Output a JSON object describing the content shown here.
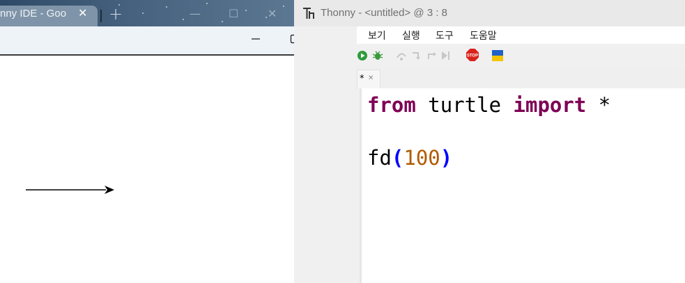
{
  "browser": {
    "tab_title": "nny IDE - Goo",
    "tab_close": "✕",
    "new_tab": "+",
    "controls": {
      "minimize": "—",
      "maximize": "☐",
      "close": "✕"
    }
  },
  "turtle_window": {
    "controls": {
      "minimize": "—",
      "maximize": "☐",
      "close": "✕"
    },
    "drawing": {
      "command": "fd(100)",
      "heading": "east",
      "pen_color": "#000000"
    }
  },
  "thonny": {
    "title": "Thonny  -  <untitled>  @  3 : 8",
    "menu": [
      "보기",
      "실행",
      "도구",
      "도움말"
    ],
    "toolbar": {
      "icons": [
        "run-icon",
        "debug-icon",
        "step-over-icon",
        "step-into-icon",
        "step-out-icon",
        "resume-icon",
        "stop-icon",
        "ukraine-flag-icon"
      ],
      "stop_label": "STOP"
    },
    "editor_tab": {
      "label": "*",
      "close": "✕"
    },
    "code": {
      "line1": {
        "kw1": "from",
        "name": " turtle ",
        "kw2": "import",
        "rest": " *"
      },
      "line3": {
        "func": "fd",
        "open": "(",
        "arg": "100",
        "close": ")"
      }
    }
  },
  "colors": {
    "keyword": "#7f0055",
    "paren": "#0000ff",
    "number": "#b05a00",
    "menu_bg": "#ffffff",
    "stop_red": "#d9221c"
  }
}
